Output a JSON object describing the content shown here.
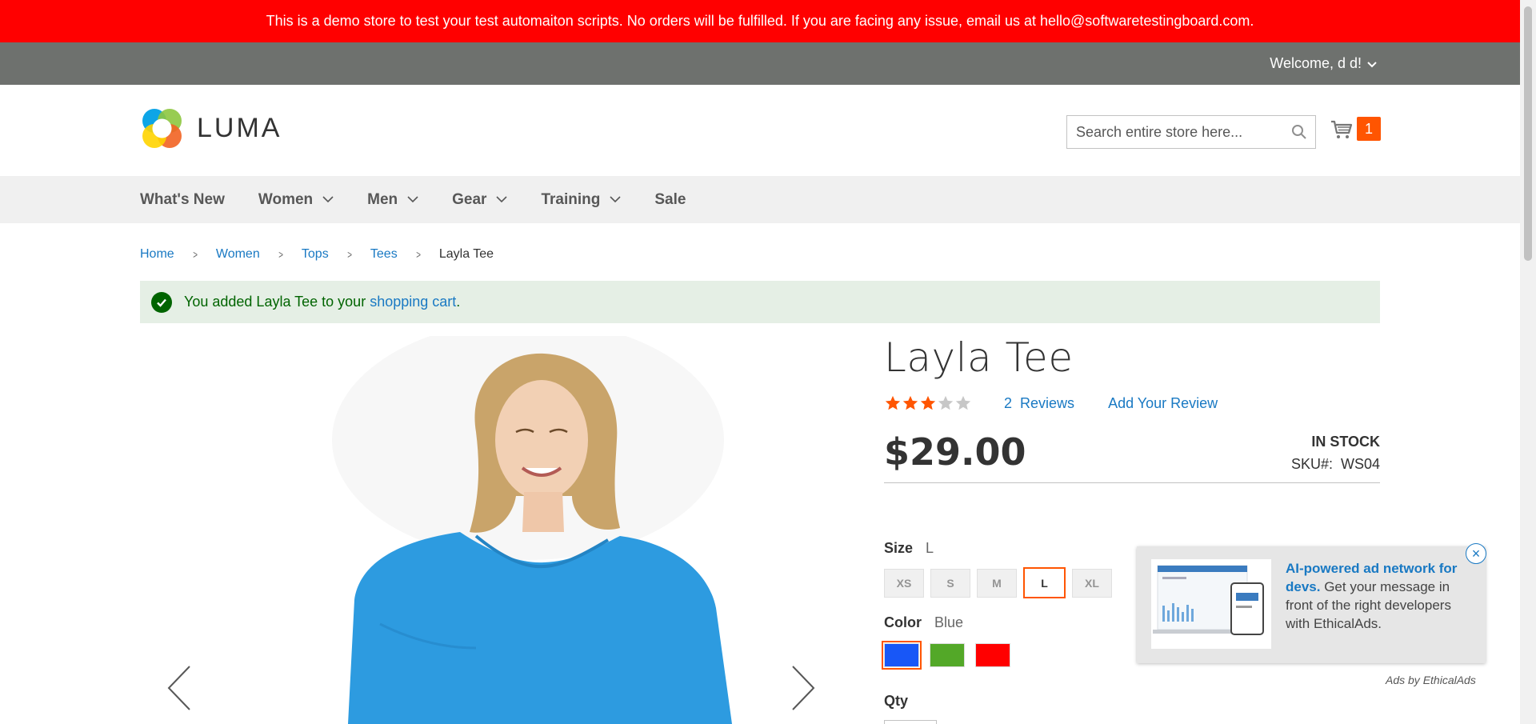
{
  "demo_notice": "This is a demo store to test your test automaiton scripts. No orders will be fulfilled. If you are facing any issue, email us at hello@softwaretestingboard.com.",
  "top_panel": {
    "welcome": "Welcome, d d!"
  },
  "header": {
    "logo_text": "LUMA",
    "search_placeholder": "Search entire store here...",
    "cart_count": "1"
  },
  "nav": {
    "items": [
      {
        "label": "What's New",
        "has_dropdown": false
      },
      {
        "label": "Women",
        "has_dropdown": true
      },
      {
        "label": "Men",
        "has_dropdown": true
      },
      {
        "label": "Gear",
        "has_dropdown": true
      },
      {
        "label": "Training",
        "has_dropdown": true
      },
      {
        "label": "Sale",
        "has_dropdown": false
      }
    ]
  },
  "breadcrumb": [
    "Home",
    "Women",
    "Tops",
    "Tees",
    "Layla Tee"
  ],
  "message": {
    "prefix": "You added Layla Tee to your ",
    "link": "shopping cart",
    "suffix": "."
  },
  "product": {
    "name": "Layla Tee",
    "rating_stars": 3,
    "rating_max": 5,
    "reviews_count": "2",
    "reviews_label": "Reviews",
    "add_review": "Add Your Review",
    "price": "$29.00",
    "stock": "IN STOCK",
    "sku_label": "SKU#:",
    "sku": "WS04",
    "size_label": "Size",
    "size_selected": "L",
    "sizes": [
      "XS",
      "S",
      "M",
      "L",
      "XL"
    ],
    "color_label": "Color",
    "color_selected": "Blue",
    "colors": [
      "#1857f7",
      "#53a828",
      "#ff0000"
    ],
    "qty_label": "Qty"
  },
  "ad": {
    "headline": "AI-powered ad network for devs.",
    "body": " Get your message in front of the right developers with EthicalAds.",
    "byline": "Ads by EthicalAds",
    "close": "×"
  },
  "colors": {
    "notice": "#ff0000",
    "top_panel": "#6e716e",
    "link": "#1979c3",
    "accent": "#ff5501"
  }
}
